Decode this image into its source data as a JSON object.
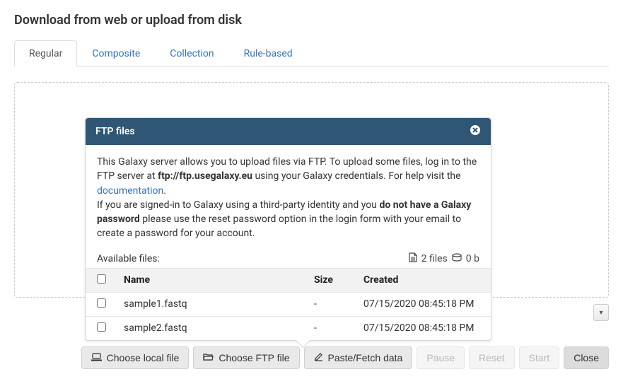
{
  "title": "Download from web or upload from disk",
  "tabs": [
    {
      "label": "Regular",
      "active": true
    },
    {
      "label": "Composite",
      "active": false
    },
    {
      "label": "Collection",
      "active": false
    },
    {
      "label": "Rule-based",
      "active": false
    }
  ],
  "ftp_popover": {
    "header": "FTP files",
    "intro_a": "This Galaxy server allows you to upload files via FTP. To upload some files, log in to the FTP server at ",
    "server": "ftp://ftp.usegalaxy.eu",
    "intro_b": " using your Galaxy credentials. For help visit the ",
    "doc_link": "documentation",
    "intro_c": ".",
    "note_a": "If you are signed-in to Galaxy using a third-party identity and you ",
    "note_bold": "do not have a Galaxy password",
    "note_b": " please use the reset password option in the login form with your email to create a password for your account.",
    "available_label": "Available files:",
    "file_count": "2 files",
    "total_size": "0 b",
    "columns": {
      "name": "Name",
      "size": "Size",
      "created": "Created"
    },
    "rows": [
      {
        "name": "sample1.fastq",
        "size": "-",
        "created": "07/15/2020 08:45:18 PM"
      },
      {
        "name": "sample2.fastq",
        "size": "-",
        "created": "07/15/2020 08:45:18 PM"
      }
    ]
  },
  "buttons": {
    "choose_local": "Choose local file",
    "choose_ftp": "Choose FTP file",
    "paste_fetch": "Paste/Fetch data",
    "pause": "Pause",
    "reset": "Reset",
    "start": "Start",
    "close": "Close"
  }
}
